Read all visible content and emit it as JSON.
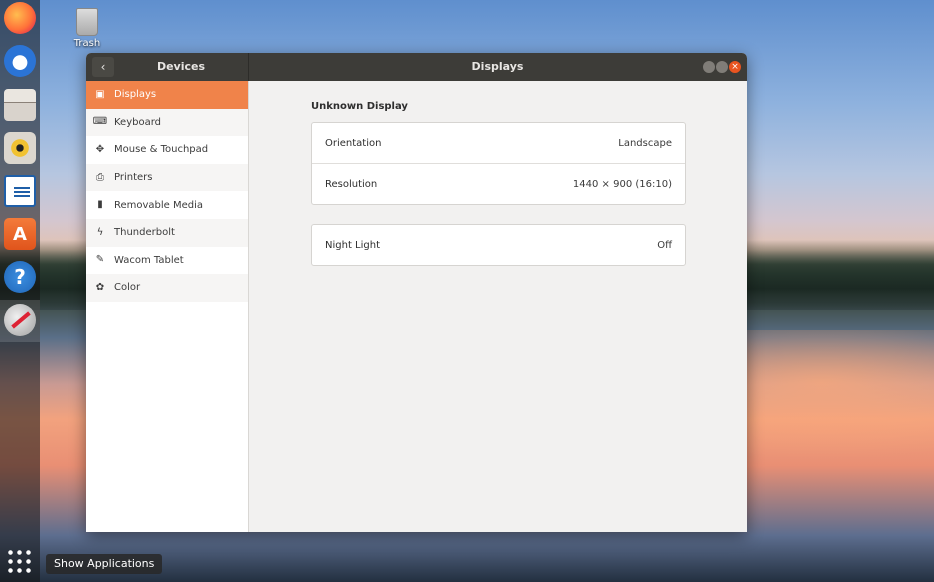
{
  "desktop": {
    "trash_label": "Trash"
  },
  "dock": {
    "icons": [
      "firefox-icon",
      "thunderbird-icon",
      "files-icon",
      "rhythmbox-icon",
      "writer-icon",
      "software-icon",
      "help-icon",
      "settings-tools-icon"
    ],
    "show_apps_tooltip": "Show Applications"
  },
  "window": {
    "panel_title": "Devices",
    "title": "Displays",
    "back_symbol": "‹",
    "close_symbol": "×"
  },
  "sidebar": {
    "items": [
      {
        "label": "Displays",
        "icon": "display-icon",
        "glyph": "▣",
        "active": true
      },
      {
        "label": "Keyboard",
        "icon": "keyboard-icon",
        "glyph": "⌨",
        "active": false
      },
      {
        "label": "Mouse & Touchpad",
        "icon": "mouse-icon",
        "glyph": "✥",
        "active": false
      },
      {
        "label": "Printers",
        "icon": "printer-icon",
        "glyph": "⎙",
        "active": false
      },
      {
        "label": "Removable Media",
        "icon": "usb-icon",
        "glyph": "▮",
        "active": false
      },
      {
        "label": "Thunderbolt",
        "icon": "thunderbolt-icon",
        "glyph": "ϟ",
        "active": false
      },
      {
        "label": "Wacom Tablet",
        "icon": "tablet-icon",
        "glyph": "✎",
        "active": false
      },
      {
        "label": "Color",
        "icon": "color-icon",
        "glyph": "✿",
        "active": false
      }
    ]
  },
  "main": {
    "section_title": "Unknown Display",
    "display_settings": [
      {
        "label": "Orientation",
        "value": "Landscape"
      },
      {
        "label": "Resolution",
        "value": "1440 × 900 (16:10)"
      }
    ],
    "night_light": {
      "label": "Night Light",
      "value": "Off"
    }
  },
  "colors": {
    "accent": "#f0834a",
    "titlebar": "#3d3c38",
    "close_button": "#e95420"
  }
}
